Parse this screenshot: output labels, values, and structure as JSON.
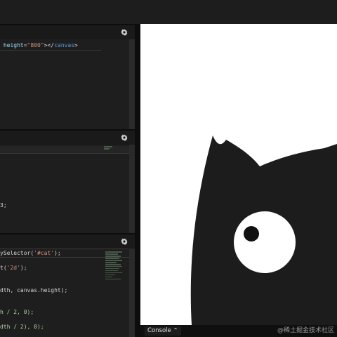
{
  "html_editor": {
    "lines": [
      [
        {
          "t": " height",
          "c": "tok-attr"
        },
        {
          "t": "=",
          "c": "tok-plain"
        },
        {
          "t": "\"800\"",
          "c": "tok-str"
        },
        {
          "t": "></",
          "c": "tok-plain"
        },
        {
          "t": "canvas",
          "c": "tok-tag"
        },
        {
          "t": ">",
          "c": "tok-plain"
        }
      ]
    ]
  },
  "css_editor": {
    "lines": [
      [],
      [],
      [],
      [
        {
          "t": "3;",
          "c": "tok-plain"
        }
      ]
    ]
  },
  "js_editor": {
    "lines": [
      [
        {
          "t": "ySelector(",
          "c": "tok-plain"
        },
        {
          "t": "'#cat'",
          "c": "tok-str"
        },
        {
          "t": ");",
          "c": "tok-plain"
        }
      ],
      [],
      [
        {
          "t": "t(",
          "c": "tok-plain"
        },
        {
          "t": "'2d'",
          "c": "tok-str"
        },
        {
          "t": ");",
          "c": "tok-plain"
        }
      ],
      [],
      [],
      [
        {
          "t": "dth, canvas.height);",
          "c": "tok-plain"
        }
      ],
      [],
      [],
      [
        {
          "t": "h / 2, 0);",
          "c": "tok-num"
        }
      ],
      [],
      [
        {
          "t": "dth / 2), 0);",
          "c": "tok-num"
        }
      ]
    ]
  },
  "console": {
    "label": "Console",
    "toggle_icon": "chevron-up-icon"
  },
  "watermark": "@稀土掘金技术社区",
  "colors": {
    "cat": "#1c1c1c",
    "eye": "#ffffff",
    "pupil": "#111111"
  }
}
